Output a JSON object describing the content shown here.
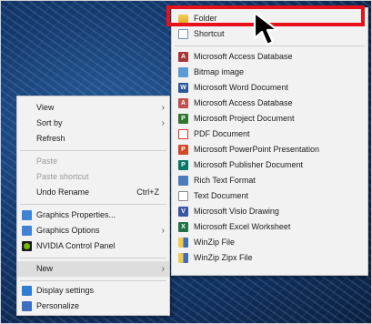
{
  "context_menu": {
    "items": [
      {
        "label": "View",
        "arrow": "›",
        "icon": ""
      },
      {
        "label": "Sort by",
        "arrow": "›",
        "icon": ""
      },
      {
        "label": "Refresh",
        "arrow": "",
        "icon": ""
      },
      {
        "label": "Paste",
        "arrow": "",
        "icon": "",
        "disabled": true
      },
      {
        "label": "Paste shortcut",
        "arrow": "",
        "icon": "",
        "disabled": true
      },
      {
        "label": "Undo Rename",
        "shortcut": "Ctrl+Z",
        "arrow": "",
        "icon": ""
      },
      {
        "label": "Graphics Properties...",
        "arrow": "",
        "icon": "intel-graphics-icon"
      },
      {
        "label": "Graphics Options",
        "arrow": "›",
        "icon": "intel-graphics-icon"
      },
      {
        "label": "NVIDIA Control Panel",
        "arrow": "",
        "icon": "nvidia-icon"
      },
      {
        "label": "New",
        "arrow": "›",
        "icon": ""
      },
      {
        "label": "Display settings",
        "arrow": "",
        "icon": "display-settings-icon"
      },
      {
        "label": "Personalize",
        "arrow": "",
        "icon": "personalize-icon"
      }
    ]
  },
  "new_menu": {
    "items": [
      {
        "label": "Folder",
        "icon": "folder-icon"
      },
      {
        "label": "Shortcut",
        "icon": "shortcut-icon"
      },
      {
        "label": "Microsoft Access Database",
        "icon": "access-icon"
      },
      {
        "label": "Bitmap image",
        "icon": "bitmap-icon"
      },
      {
        "label": "Microsoft Word Document",
        "icon": "word-icon"
      },
      {
        "label": "Microsoft Access Database",
        "icon": "access-icon"
      },
      {
        "label": "Microsoft Project Document",
        "icon": "project-icon"
      },
      {
        "label": "PDF Document",
        "icon": "pdf-icon"
      },
      {
        "label": "Microsoft PowerPoint Presentation",
        "icon": "powerpoint-icon"
      },
      {
        "label": "Microsoft Publisher Document",
        "icon": "publisher-icon"
      },
      {
        "label": "Rich Text Format",
        "icon": "rtf-icon"
      },
      {
        "label": "Text Document",
        "icon": "text-document-icon"
      },
      {
        "label": "Microsoft Visio Drawing",
        "icon": "visio-icon"
      },
      {
        "label": "Microsoft Excel Worksheet",
        "icon": "excel-icon"
      },
      {
        "label": "WinZip File",
        "icon": "winzip-icon"
      },
      {
        "label": "WinZip Zipx File",
        "icon": "winzip-icon"
      }
    ]
  },
  "colors": {
    "highlight_border": "#e8111b",
    "menu_bg": "#f2f2f2",
    "access": "#a4373a",
    "word": "#2b579a",
    "excel": "#217346",
    "powerpoint": "#d24726",
    "project": "#31752f",
    "publisher": "#077568",
    "visio": "#3955a3",
    "pdf": "#d9302a"
  }
}
